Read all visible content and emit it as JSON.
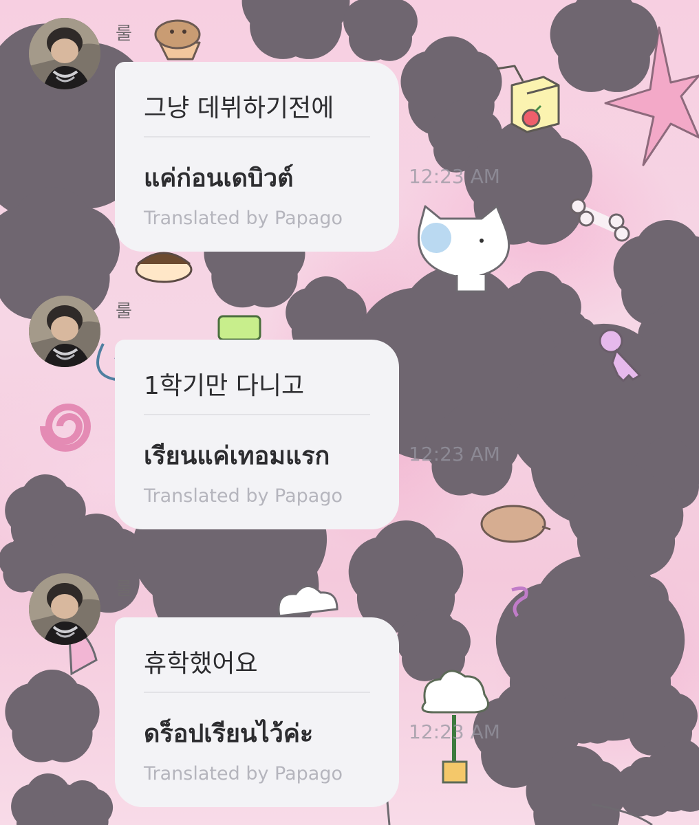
{
  "messages": [
    {
      "sender": "룰",
      "original": "그냥 데뷔하기전에",
      "translated": "แค่ก่อนเดบิวต์",
      "translation_credit": "Translated by Papago",
      "time": "12:23 AM"
    },
    {
      "sender": "룰",
      "original": "1학기만 다니고",
      "translated": "เรียนแค่เทอมแรก",
      "translation_credit": "Translated by Papago",
      "time": "12:23 AM"
    },
    {
      "sender": "룰",
      "original": "휴학했어요",
      "translated": "ดร็อปเรียนไว้ค่ะ",
      "translation_credit": "Translated by Papago",
      "time": "12:23 AM"
    }
  ],
  "colors": {
    "bubble": "#f3f3f6",
    "text": "#2d2d30",
    "credit": "#b5b5bd",
    "background": "#f6d2e3"
  },
  "wallpaper_icons": [
    "star-icon",
    "cat-icon",
    "juice-box-icon",
    "bone-icon",
    "cloud-icon",
    "key-icon",
    "spiral-icon",
    "pig-icon",
    "muffin-icon",
    "flower-icon"
  ]
}
